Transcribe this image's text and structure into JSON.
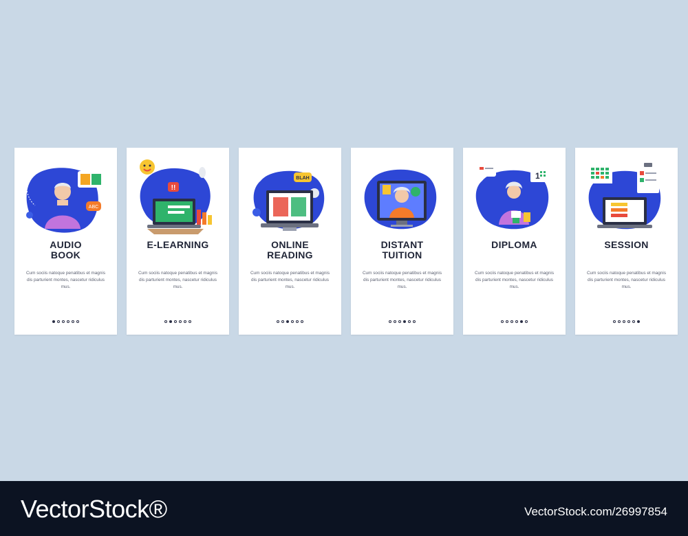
{
  "cards": [
    {
      "title": "AUDIO\nBOOK",
      "body": "Cum sociis natoque penatibus et magnis dis parturient montes, nascetur ridiculus mus.",
      "active": 0,
      "illustration": "audio-book-illustration"
    },
    {
      "title": "E-LEARNING",
      "body": "Cum sociis natoque penatibus et magnis dis parturient montes, nascetur ridiculus mus.",
      "active": 1,
      "illustration": "e-learning-illustration"
    },
    {
      "title": "ONLINE\nREADING",
      "body": "Cum sociis natoque penatibus et magnis dis parturient montes, nascetur ridiculus mus.",
      "active": 2,
      "illustration": "online-reading-illustration"
    },
    {
      "title": "DISTANT\nTUITION",
      "body": "Cum sociis natoque penatibus et magnis dis parturient montes, nascetur ridiculus mus.",
      "active": 3,
      "illustration": "distant-tuition-illustration"
    },
    {
      "title": "DIPLOMA",
      "body": "Cum sociis natoque penatibus et magnis dis parturient montes, nascetur ridiculus mus.",
      "active": 4,
      "illustration": "diploma-illustration"
    },
    {
      "title": "SESSION",
      "body": "Cum sociis natoque penatibus et magnis dis parturient montes, nascetur ridiculus mus.",
      "active": 5,
      "illustration": "session-illustration"
    }
  ],
  "dot_count": 6,
  "footer": {
    "brand": "VectorStock®",
    "stock_id": "VectorStock.com/26997854"
  },
  "colors": {
    "background": "#c9d8e6",
    "blob": "#2d47d6",
    "footer": "#0c1322"
  }
}
